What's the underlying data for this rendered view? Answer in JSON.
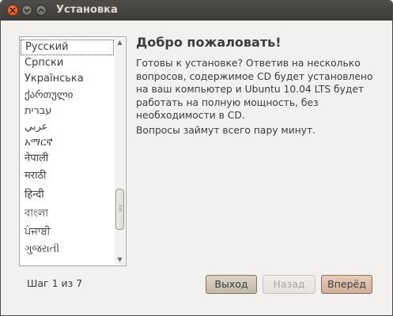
{
  "window": {
    "title": "Установка"
  },
  "language_list": {
    "items": [
      {
        "label": "Русский",
        "selected": true
      },
      {
        "label": "Српски"
      },
      {
        "label": "Українська"
      },
      {
        "label": "ქართული"
      },
      {
        "label": "עברית"
      },
      {
        "label": "عربي"
      },
      {
        "label": "አማርኛ"
      },
      {
        "label": "नेपाली"
      },
      {
        "label": "मराठी"
      },
      {
        "label": "हिन्दी"
      },
      {
        "label": "বাংলা"
      },
      {
        "label": "ਪੰਜਾਬੀ"
      },
      {
        "label": "ગુજરાતી"
      }
    ]
  },
  "welcome": {
    "heading": "Добро пожаловать!",
    "paragraph1": "Готовы к установке? Ответив на несколько вопросов, содержимое CD будет установлено на ваш компьютер и Ubuntu 10.04 LTS будет работать на полную мощность, без необходимости в CD.",
    "paragraph2": "Вопросы займут всего пару минут."
  },
  "footer": {
    "step": "Шаг 1 из 7",
    "quit_label": "Выход",
    "back_label": "Назад",
    "forward_label": "Вперёд"
  },
  "colors": {
    "titlebar": "#3c3b37",
    "close_button": "#df4a16",
    "forward_button": "#cfae98"
  }
}
